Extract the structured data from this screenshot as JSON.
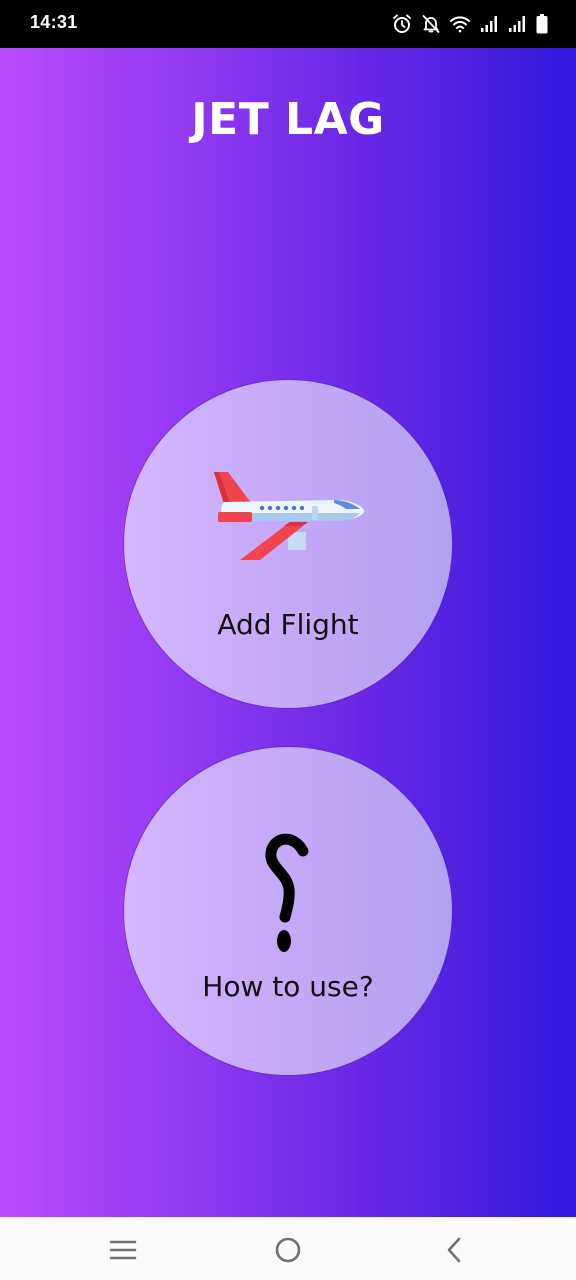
{
  "status_bar": {
    "time": "14:31",
    "icons": [
      "alarm-icon",
      "notifications-off-icon",
      "wifi-icon",
      "signal-icon",
      "signal-icon",
      "battery-icon"
    ]
  },
  "app": {
    "title": "JET LAG",
    "background_gradient": [
      "#bb4bff",
      "#3119dc"
    ],
    "buttons": [
      {
        "label": "Add Flight",
        "icon": "airplane-icon"
      },
      {
        "label": "How to use?",
        "icon": "question-mark-icon"
      }
    ]
  },
  "nav_bar": {
    "items": [
      "menu-icon",
      "home-icon",
      "back-icon"
    ]
  }
}
